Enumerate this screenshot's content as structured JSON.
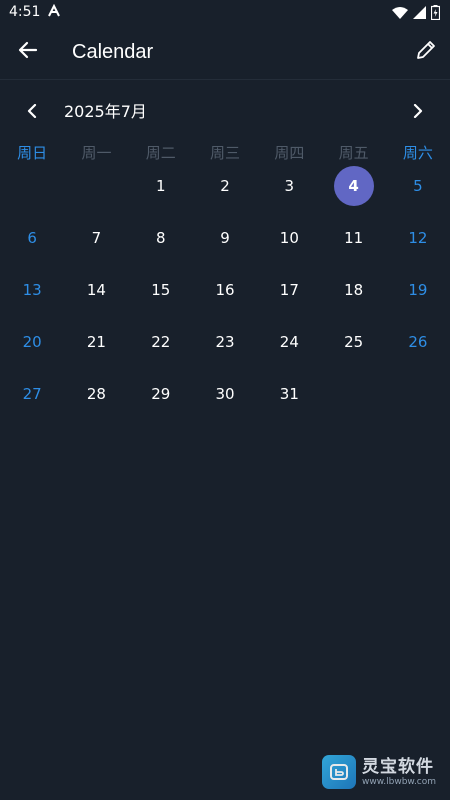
{
  "status_bar": {
    "time": "4:51",
    "icons": [
      "a-notification-icon",
      "wifi-icon",
      "signal-icon",
      "battery-icon"
    ]
  },
  "app_bar": {
    "title": "Calendar",
    "back_icon": "arrow-left-icon",
    "edit_icon": "pencil-icon"
  },
  "month_nav": {
    "label": "2025年7月",
    "prev_icon": "chevron-left-icon",
    "next_icon": "chevron-right-icon"
  },
  "weekdays": [
    "周日",
    "周一",
    "周二",
    "周三",
    "周四",
    "周五",
    "周六"
  ],
  "calendar": {
    "leading_empty": 2,
    "selected_day": "4",
    "weeks": [
      [
        "",
        "",
        "1",
        "2",
        "3",
        "4",
        "5"
      ],
      [
        "6",
        "7",
        "8",
        "9",
        "10",
        "11",
        "12"
      ],
      [
        "13",
        "14",
        "15",
        "16",
        "17",
        "18",
        "19"
      ],
      [
        "20",
        "21",
        "22",
        "23",
        "24",
        "25",
        "26"
      ],
      [
        "27",
        "28",
        "29",
        "30",
        "31",
        "",
        ""
      ]
    ]
  },
  "colors": {
    "background": "#18202b",
    "weekend": "#2e8ee6",
    "selected": "#6167c4",
    "weekday_header": "#4f5a68"
  },
  "watermark": {
    "name": "灵宝软件",
    "url": "www.lbwbw.com"
  }
}
